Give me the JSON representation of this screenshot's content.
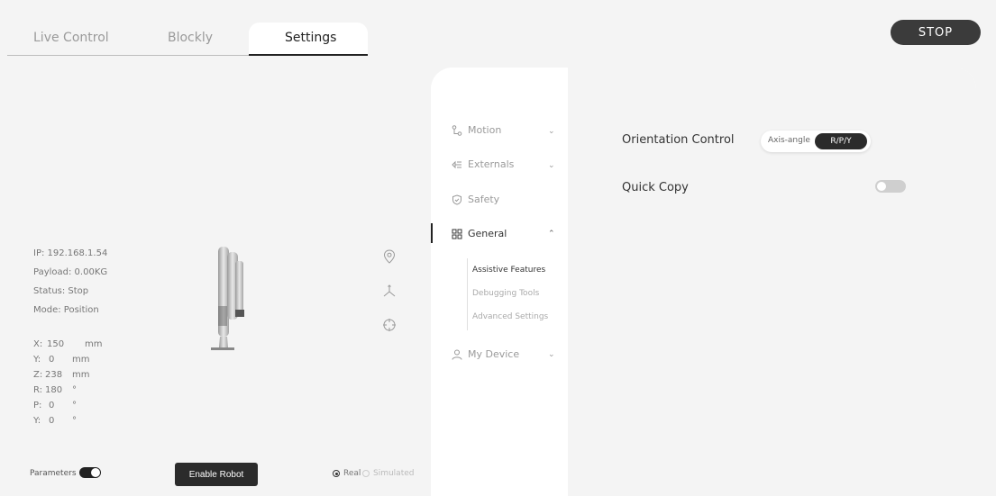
{
  "tabs": {
    "live_control": "Live Control",
    "blockly": "Blockly",
    "settings": "Settings"
  },
  "stop_label": "STOP",
  "robot_info": {
    "ip": "IP: 192.168.1.54",
    "payload": "Payload: 0.00KG",
    "status": "Status: Stop",
    "mode": "Mode: Position"
  },
  "coordinates": [
    {
      "axis": "X:",
      "value": "150",
      "unit": "mm"
    },
    {
      "axis": "Y:",
      "value": "0",
      "unit": "mm"
    },
    {
      "axis": "Z:",
      "value": "238",
      "unit": "mm"
    },
    {
      "axis": "R:",
      "value": "180",
      "unit": "°"
    },
    {
      "axis": "P:",
      "value": "0",
      "unit": "°"
    },
    {
      "axis": "Y:",
      "value": "0",
      "unit": "°"
    }
  ],
  "side_icons": [
    "location-pin-icon",
    "axis-icon",
    "target-icon"
  ],
  "bottom": {
    "parameters_label": "Parameters",
    "parameters_on": true,
    "enable_robot_label": "Enable Robot",
    "mode_real": "Real",
    "mode_simulated": "Simulated",
    "selected_mode": "Real"
  },
  "nav": {
    "motion": "Motion",
    "externals": "Externals",
    "safety": "Safety",
    "general": "General",
    "general_items": [
      "Assistive Features",
      "Debugging Tools",
      "Advanced Settings"
    ],
    "my_device": "My Device"
  },
  "content": {
    "orientation_control_label": "Orientation Control",
    "orientation_options": [
      "Axis-angle",
      "R/P/Y"
    ],
    "orientation_selected": "R/P/Y",
    "quick_copy_label": "Quick Copy",
    "quick_copy_on": false
  }
}
